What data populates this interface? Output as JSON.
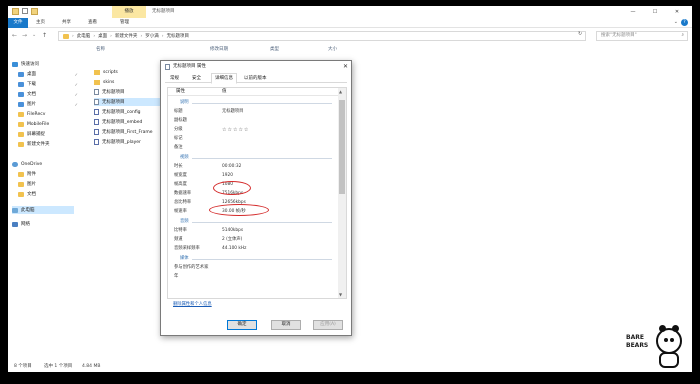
{
  "titlebar": {
    "tool_tab": "播放",
    "title": "无标题项目",
    "controls": [
      "—",
      "☐",
      "✕"
    ]
  },
  "ribbon": {
    "file": "文件",
    "tabs": [
      "主页",
      "共享",
      "查看",
      "管理"
    ]
  },
  "address": {
    "path": [
      "此电脑",
      "桌面",
      "新建文件夹",
      "罗小满",
      "无标题项目"
    ],
    "search_placeholder": "搜索\"无标题项目\""
  },
  "sidebar": {
    "items": [
      {
        "label": "快速访问",
        "icon": "star-icon"
      },
      {
        "label": "桌面",
        "icon": "desktop-icon",
        "pinned": true
      },
      {
        "label": "下载",
        "icon": "download-icon",
        "pinned": true
      },
      {
        "label": "文档",
        "icon": "document-icon",
        "pinned": true
      },
      {
        "label": "图片",
        "icon": "picture-icon",
        "pinned": true
      },
      {
        "label": "FileRecv",
        "icon": "folder-icon"
      },
      {
        "label": "MobileFile",
        "icon": "folder-icon"
      },
      {
        "label": "屏幕捕捉",
        "icon": "folder-icon"
      },
      {
        "label": "新建文件夹",
        "icon": "folder-icon"
      },
      {
        "label": "OneDrive",
        "icon": "cloud-icon"
      },
      {
        "label": "附件",
        "icon": "folder-icon"
      },
      {
        "label": "图片",
        "icon": "folder-icon"
      },
      {
        "label": "文档",
        "icon": "folder-icon"
      },
      {
        "label": "此电脑",
        "icon": "computer-icon",
        "selected": true
      },
      {
        "label": "网络",
        "icon": "network-icon"
      }
    ]
  },
  "filelist": {
    "columns": [
      "名称",
      "修改日期",
      "类型",
      "大小"
    ],
    "files": [
      {
        "name": "scripts",
        "type": "folder"
      },
      {
        "name": "skins",
        "type": "folder"
      },
      {
        "name": "无标题项目",
        "type": "video"
      },
      {
        "name": "无标题项目",
        "type": "video",
        "selected": true
      },
      {
        "name": "无标题项目_config",
        "type": "doc"
      },
      {
        "name": "无标题项目_embed",
        "type": "doc"
      },
      {
        "name": "无标题项目_First_Frame",
        "type": "doc"
      },
      {
        "name": "无标题项目_player",
        "type": "doc"
      }
    ]
  },
  "status": {
    "count": "8 个项目",
    "selected": "选中 1 个项目",
    "size": "4.84 MB"
  },
  "dialog": {
    "title": "无标题项目 属性",
    "tabs": [
      "常规",
      "安全",
      "详细信息",
      "以前的版本"
    ],
    "header_prop": "属性",
    "header_val": "值",
    "sections": {
      "desc": "说明",
      "video": "视频",
      "audio": "音频",
      "media": "媒体"
    },
    "props": {
      "title_k": "标题",
      "title_v": "无标题项目",
      "subtitle_k": "副标题",
      "rating_k": "分级",
      "rating_v": "☆☆☆☆☆",
      "tags_k": "标记",
      "comment_k": "备注",
      "length_k": "时长",
      "length_v": "00:00:32",
      "width_k": "帧宽度",
      "width_v": "1920",
      "height_k": "帧高度",
      "height_v": "1080",
      "datarate_k": "数据速率",
      "datarate_v": "7516kbps",
      "totalbitrate_k": "总比特率",
      "totalbitrate_v": "12656kbps",
      "framerate_k": "帧速率",
      "framerate_v": "30.00 帧/秒",
      "bitrate_k": "比特率",
      "bitrate_v": "5140kbps",
      "channels_k": "频道",
      "channels_v": "2 (立体声)",
      "samplerate_k": "音频采样频率",
      "samplerate_v": "44.100 kHz",
      "contrib_k": "参与创作的艺术家",
      "year_k": "年"
    },
    "remove_link": "删除属性和个人信息",
    "buttons": {
      "ok": "确定",
      "cancel": "取消",
      "apply": "应用(A)"
    }
  },
  "watermark": {
    "line1": "BARE",
    "line2": "BEARS"
  }
}
